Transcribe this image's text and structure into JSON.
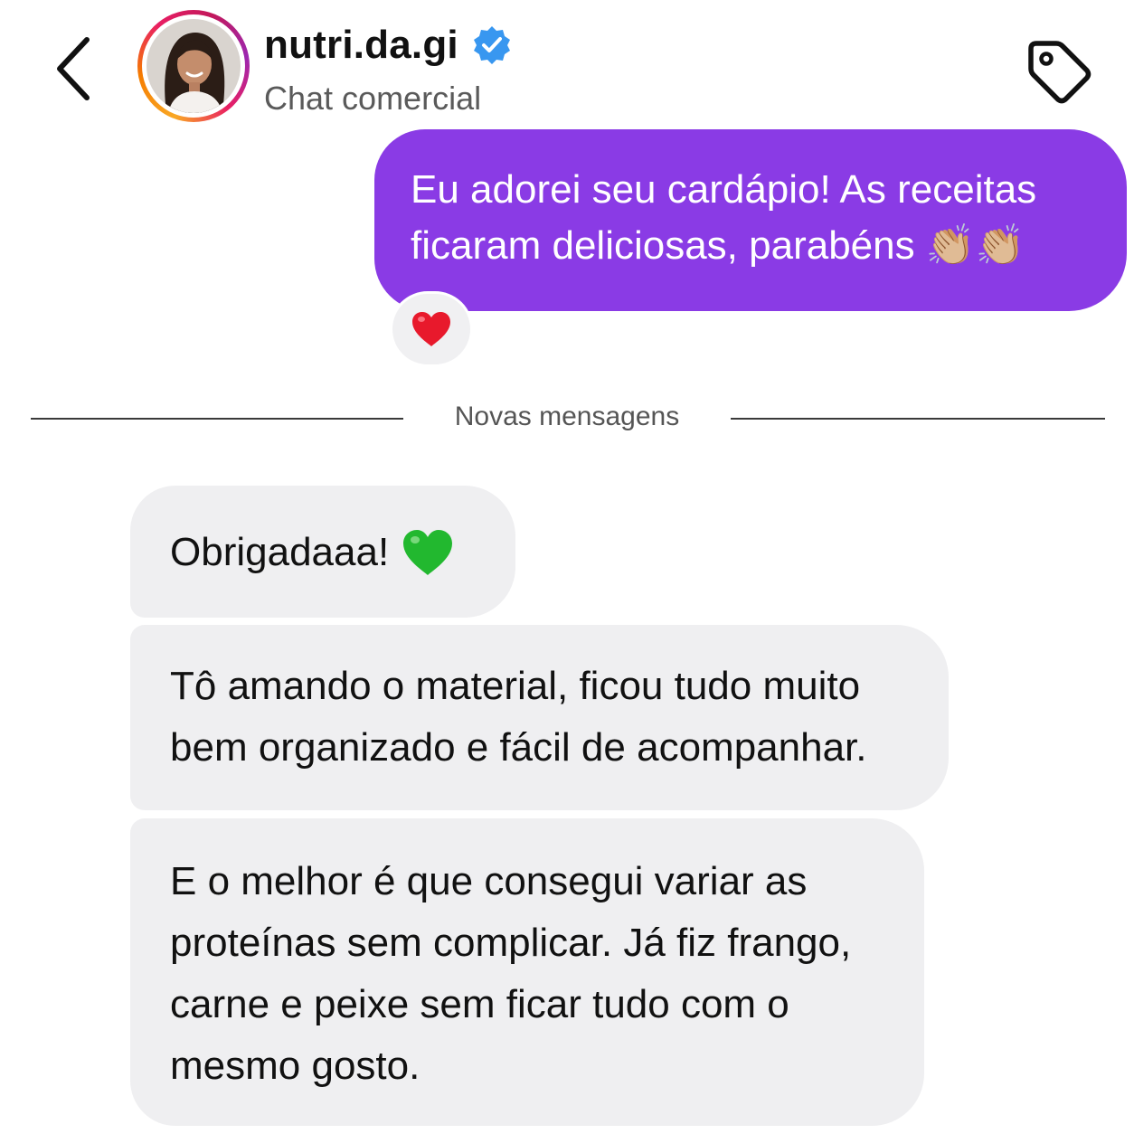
{
  "header": {
    "account_name": "nutri.da.gi",
    "subtitle": "Chat comercial",
    "back_icon": "chevron-left-icon",
    "verified_icon": "verified-badge-icon",
    "tag_icon": "tag-icon"
  },
  "sent_message": {
    "lines": [
      "Eu adorei seu cardápio! As receitas",
      "ficaram deliciosas, parabéns"
    ],
    "emojis": "👏🏼👏🏼",
    "reaction": "❤️"
  },
  "divider": {
    "label": "Novas mensagens"
  },
  "received_messages": [
    {
      "lines": [
        "Obrigadaaa!"
      ],
      "emoji": "💚"
    },
    {
      "lines": [
        "Tô amando o material, ficou tudo muito",
        "bem organizado e fácil de acompanhar."
      ]
    },
    {
      "lines": [
        "E o melhor é que consegui variar as",
        "proteínas sem complicar. Já fiz frango,",
        "carne e peixe sem ficar tudo com o",
        "mesmo gosto."
      ]
    }
  ],
  "colors": {
    "sent_bubble": "#8a3be5",
    "received_bubble": "#efeff1",
    "verified": "#3897f0"
  }
}
